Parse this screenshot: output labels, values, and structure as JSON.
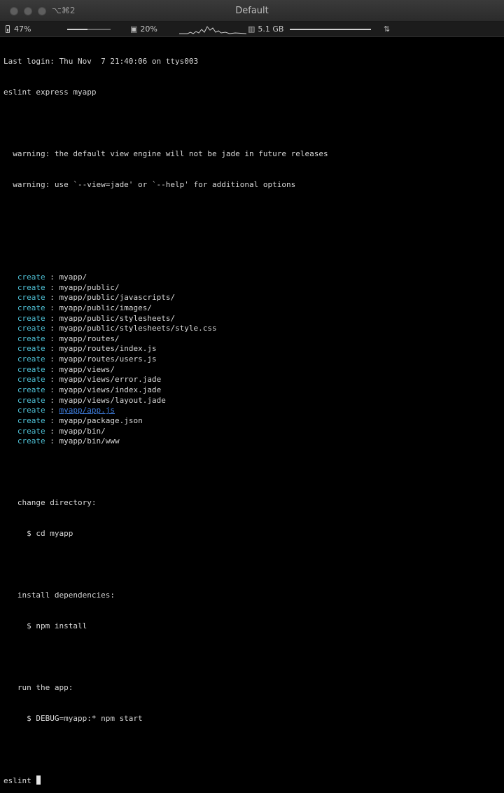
{
  "window": {
    "title": "Default",
    "shortcut": "⌥⌘2"
  },
  "status": {
    "battery": "47%",
    "battery_level": 0.47,
    "cpu": "20%",
    "cpu_level": 0.2,
    "memory": "5.1 GB",
    "network_icon": "network-icon"
  },
  "terminal": {
    "login": "Last login: Thu Nov  7 21:40:06 on ttys003",
    "command": "eslint express myapp",
    "warnings": [
      "  warning: the default view engine will not be jade in future releases",
      "  warning: use `--view=jade' or `--help' for additional options"
    ],
    "create_label": "create",
    "created": [
      "myapp/",
      "myapp/public/",
      "myapp/public/javascripts/",
      "myapp/public/images/",
      "myapp/public/stylesheets/",
      "myapp/public/stylesheets/style.css",
      "myapp/routes/",
      "myapp/routes/index.js",
      "myapp/routes/users.js",
      "myapp/views/",
      "myapp/views/error.jade",
      "myapp/views/index.jade",
      "myapp/views/layout.jade",
      "myapp/app.js",
      "myapp/package.json",
      "myapp/bin/",
      "myapp/bin/www"
    ],
    "linked_index": 13,
    "change_dir_label": "   change directory:",
    "change_dir_cmd": "     $ cd myapp",
    "install_label": "   install dependencies:",
    "install_cmd": "     $ npm install",
    "run_label": "   run the app:",
    "run_cmd": "     $ DEBUG=myapp:* npm start",
    "prompt": "eslint "
  },
  "colors": {
    "create": "#4fc1d6",
    "link": "#3f7fe0",
    "background": "#000000"
  }
}
